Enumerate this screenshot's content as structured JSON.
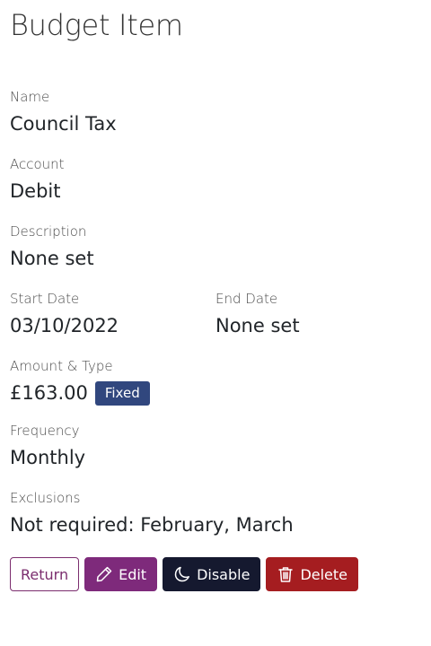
{
  "page": {
    "title": "Budget Item"
  },
  "fields": {
    "name": {
      "label": "Name",
      "value": "Council Tax"
    },
    "account": {
      "label": "Account",
      "value": "Debit"
    },
    "description": {
      "label": "Description",
      "value": "None set"
    },
    "start_date": {
      "label": "Start Date",
      "value": "03/10/2022"
    },
    "end_date": {
      "label": "End Date",
      "value": "None set"
    },
    "amount_type": {
      "label": "Amount & Type",
      "amount": "£163.00",
      "type_badge": "Fixed"
    },
    "frequency": {
      "label": "Frequency",
      "value": "Monthly"
    },
    "exclusions": {
      "label": "Exclusions",
      "value": "Not required: February, March"
    }
  },
  "actions": {
    "return_label": "Return",
    "edit_label": "Edit",
    "disable_label": "Disable",
    "delete_label": "Delete"
  },
  "icons": {
    "edit": "pencil-icon",
    "disable": "moon-icon",
    "delete": "trash-icon"
  },
  "colors": {
    "badge": "#31477e",
    "return_border": "#7b2d6e",
    "edit_bg": "#7e2a7b",
    "disable_bg": "#15192f",
    "delete_bg": "#a51d20"
  }
}
